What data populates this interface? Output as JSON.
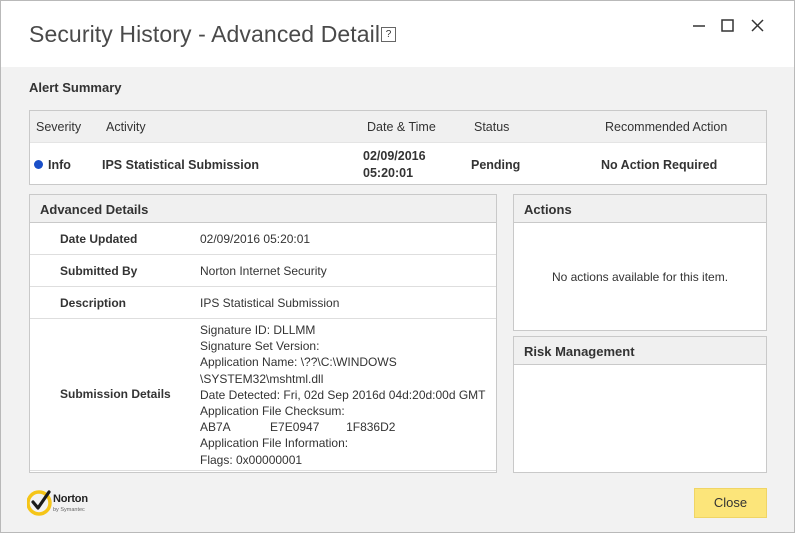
{
  "window": {
    "title": "Security History - Advanced Details",
    "help_glyph": "?"
  },
  "alert_summary": {
    "heading": "Alert Summary",
    "columns": [
      "Severity",
      "Activity",
      "Date & Time",
      "Status",
      "Recommended Action"
    ],
    "row": {
      "severity": "Info",
      "severity_color": "#1a4fc8",
      "activity": "IPS Statistical Submission",
      "date": "02/09/2016",
      "time": "05:20:01",
      "status": "Pending",
      "recommended_action": "No Action Required"
    }
  },
  "advanced_details": {
    "heading": "Advanced Details",
    "rows": [
      {
        "label": "Date Updated",
        "value": "02/09/2016 05:20:01"
      },
      {
        "label": "Submitted By",
        "value": "Norton Internet Security"
      },
      {
        "label": "Description",
        "value": "IPS Statistical Submission"
      },
      {
        "label": "Submission Details",
        "lines": [
          "Signature ID: DLLMM",
          "Signature Set Version:",
          "Application Name: \\??\\C:\\WINDOWS",
          "\\SYSTEM32\\mshtml.dll",
          "Date Detected: Fri, 02d Sep 2016d 04d:20d:00d GMT",
          "Application File Checksum:",
          "AB7A            E7E0947        1F836D2",
          "Application File Information:",
          "Flags: 0x00000001"
        ]
      }
    ]
  },
  "actions": {
    "heading": "Actions",
    "message": "No actions available for this item."
  },
  "risk_management": {
    "heading": "Risk Management"
  },
  "footer": {
    "logo_name": "Norton",
    "logo_sub": "by Symantec",
    "close_label": "Close"
  }
}
